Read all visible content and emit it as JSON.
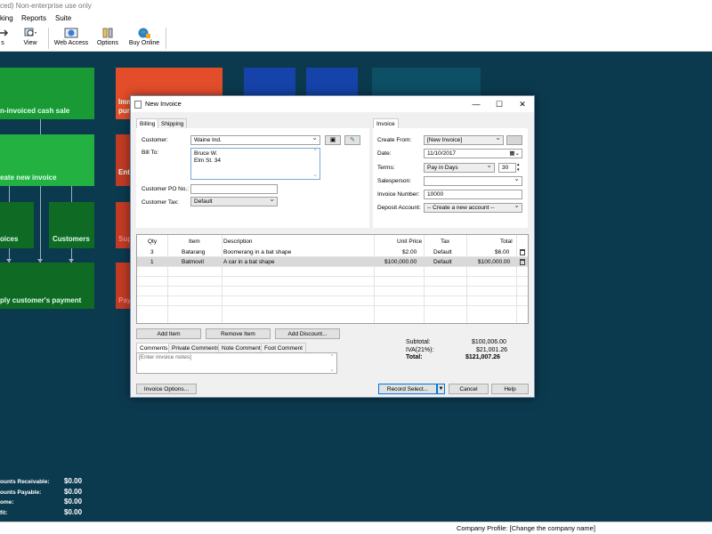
{
  "app": {
    "title_fragment": "ced) Non-enterprise use only",
    "menu": [
      "king",
      "Reports",
      "Suite"
    ],
    "toolbar": [
      {
        "label": "s",
        "icon": "arrow-icon"
      },
      {
        "label": "View",
        "icon": "view-icon"
      },
      {
        "label": "Web Access",
        "icon": "globe-icon"
      },
      {
        "label": "Options",
        "icon": "options-icon"
      },
      {
        "label": "Buy Online",
        "icon": "buy-online-icon"
      }
    ]
  },
  "dashboard": {
    "tiles": {
      "cash_sale": "n-invoiced cash sale",
      "create_invoice": "eate new invoice",
      "invoices": "oices",
      "customers": "Customers",
      "payment": "ply customer's payment",
      "imm": "Imm",
      "pur": "pur",
      "ent": "Ent",
      "sup": "Sup",
      "pay": "Pay"
    },
    "colors": {
      "background": "#0b3a4f",
      "green_bright": "#1a9a35",
      "green_mid": "#23b142",
      "green_dark": "#0f6b24",
      "orange": "#e34d2a",
      "red": "#c23b25",
      "blue": "#1643a9",
      "teal": "#0d4f65"
    },
    "summary": [
      {
        "label": "ounts Receivable:",
        "value": "$0.00"
      },
      {
        "label": "ounts Payable:",
        "value": "$0.00"
      },
      {
        "label": "ome:",
        "value": "$0.00"
      },
      {
        "label": "fit:",
        "value": "$0.00"
      }
    ]
  },
  "status": {
    "company_profile": "Company Profile: [Change the company name]"
  },
  "dialog": {
    "title": "New Invoice",
    "controls": {
      "minimize": "—",
      "maximize": "☐",
      "close": "✕"
    },
    "left_tabs": [
      "Billing",
      "Shipping"
    ],
    "billing": {
      "customer_label": "Customer:",
      "customer_value": "Waine Ind.",
      "bill_to_label": "Bill To:",
      "bill_to_line1": "Bruce W.",
      "bill_to_line2": "Elm St. 34",
      "po_label": "Customer PO No.:",
      "po_value": "",
      "tax_label": "Customer Tax:",
      "tax_value": "Default"
    },
    "right_tab": "Invoice",
    "invoice": {
      "create_from_label": "Create From:",
      "create_from_value": "[New Invoice]",
      "date_label": "Date:",
      "date_value": "11/10/2017",
      "terms_label": "Terms:",
      "terms_value": "Pay in Days",
      "terms_days": "30",
      "salesperson_label": "Salesperson:",
      "salesperson_value": "",
      "number_label": "Invoice Number:",
      "number_value": "10000",
      "deposit_label": "Deposit Account:",
      "deposit_value": "-- Create a new account --"
    },
    "grid": {
      "headers": {
        "qty": "Qty",
        "item": "Item",
        "description": "Description",
        "unit_price": "Unit Price",
        "tax": "Tax",
        "total": "Total"
      },
      "rows": [
        {
          "qty": "3",
          "item": "Batarang",
          "description": "Boomerang in a bat shape",
          "unit_price": "$2.00",
          "tax": "Default",
          "total": "$6.00"
        },
        {
          "qty": "1",
          "item": "Batmovil",
          "description": "A car in a bat shape",
          "unit_price": "$100,000.00",
          "tax": "Default",
          "total": "$100,000.00"
        }
      ]
    },
    "buttons": {
      "add_item": "Add Item",
      "remove_item": "Remove Item",
      "add_discount": "Add Discount...",
      "invoice_options": "Invoice Options...",
      "record_select": "Record Select...",
      "cancel": "Cancel",
      "help": "Help"
    },
    "comment_tabs": [
      "Comments",
      "Private Comments",
      "Note Comment",
      "Foot Comment"
    ],
    "comments_placeholder": "[Enter invoice notes]",
    "totals": {
      "subtotal_label": "Subtotal:",
      "subtotal_value": "$100,006.00",
      "tax_label": "IVA(21%):",
      "tax_value": "$21,001.26",
      "total_label": "Total:",
      "total_value": "$121,007.26"
    }
  }
}
